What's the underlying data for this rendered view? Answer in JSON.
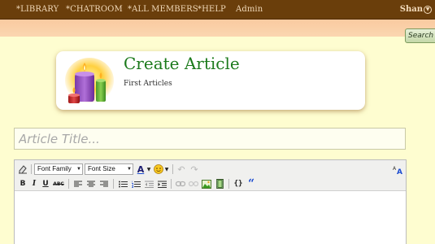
{
  "nav": {
    "items": [
      "*LIBRARY",
      "*CHATROOM",
      "*ALL MEMBERS",
      "*HELP",
      "Admin"
    ],
    "user": "Shan"
  },
  "search": {
    "label": "Search"
  },
  "header": {
    "title": "Create Article",
    "subtitle": "First Articles"
  },
  "article_title": {
    "placeholder": "Article Title..."
  },
  "toolbar": {
    "font_family": "Font Family",
    "font_size": "Font Size",
    "bold": "B",
    "italic": "I",
    "underline": "U",
    "strike": "ABC",
    "forecolor": "A",
    "insert_code": "{}",
    "blockquote": "“"
  },
  "colors": {
    "nav_bg": "#6a3e0b",
    "title_green": "#1c7a1c",
    "page_bg": "#fefdd0"
  }
}
